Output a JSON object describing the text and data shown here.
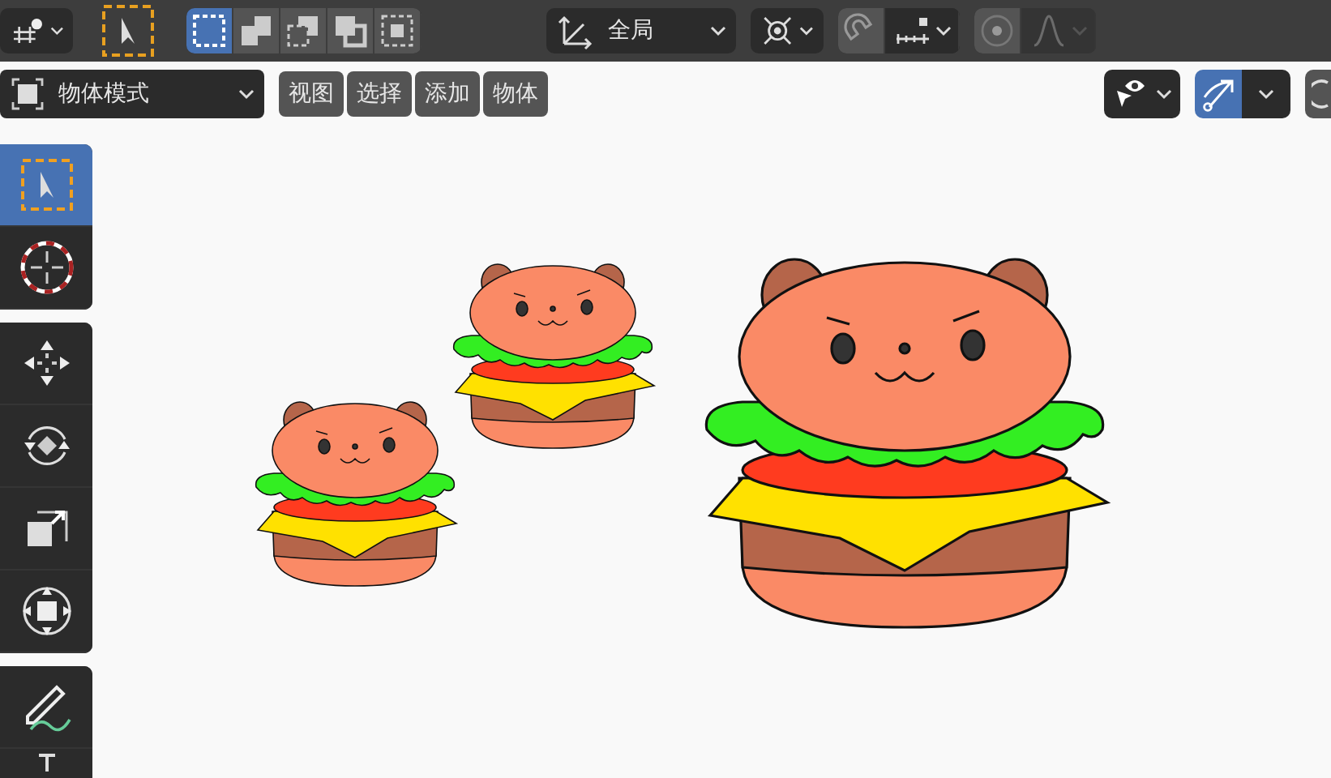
{
  "header": {
    "select_modes": [
      {
        "selected": true
      },
      {
        "selected": false
      },
      {
        "selected": false
      },
      {
        "selected": false
      },
      {
        "selected": false
      }
    ],
    "orientation": {
      "label": "全局"
    },
    "snap": {
      "on": false
    },
    "proportional_editing": {
      "on": false
    }
  },
  "viewport_header": {
    "mode": {
      "label": "物体模式"
    },
    "menus": [
      "视图",
      "选择",
      "添加",
      "物体"
    ],
    "gizmos": {
      "on": true
    }
  },
  "toolbar": {
    "groups": [
      {
        "tools": [
          {
            "kind": "select",
            "selected": true
          },
          {
            "kind": "cursor",
            "selected": false
          }
        ]
      },
      {
        "tools": [
          {
            "kind": "move",
            "selected": false
          },
          {
            "kind": "rotate",
            "selected": false
          },
          {
            "kind": "scale",
            "selected": false
          },
          {
            "kind": "transform",
            "selected": false
          }
        ]
      },
      {
        "tools": [
          {
            "kind": "annotate",
            "selected": false
          },
          {
            "kind": "measure",
            "selected": false
          }
        ]
      }
    ]
  }
}
